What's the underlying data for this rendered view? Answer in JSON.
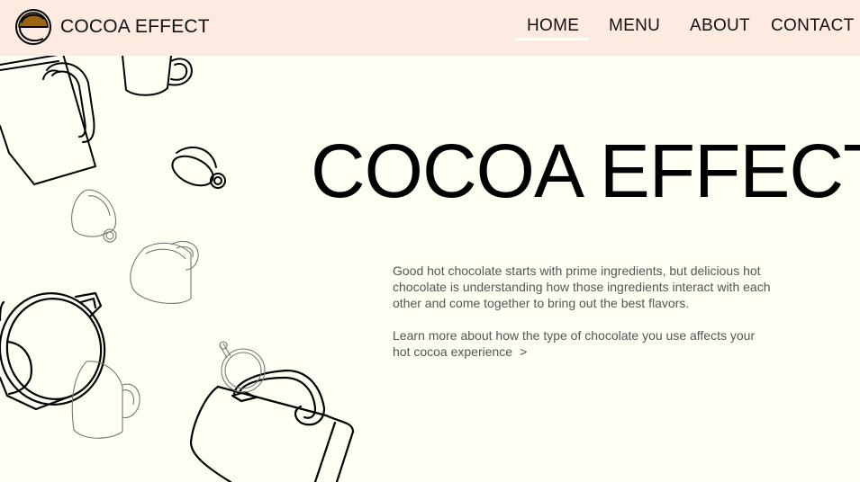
{
  "brand": {
    "name": "COCOA EFFECT",
    "logo_color": "#9a6410"
  },
  "nav": {
    "items": [
      {
        "label": "HOME",
        "active": true
      },
      {
        "label": "MENU"
      },
      {
        "label": "ABOUT"
      },
      {
        "label": "CONTACT"
      }
    ]
  },
  "hero": {
    "title": "COCOA EFFECT",
    "paragraph": "Good hot chocolate starts with prime ingredients, but delicious hot chocolate is understanding how those ingredients interact with each other and come together to bring out the best flavors.",
    "learn_more": "Learn more about how the type of chocolate you use affects your hot cocoa experience",
    "learn_more_chevron": ">"
  },
  "colors": {
    "page_background": "#fefef3",
    "navbar_background": "#fdebe1",
    "text": "#111111",
    "body_text": "#555555"
  },
  "icons": [
    "cocoa-logo-icon",
    "mug-illustration",
    "cup-illustration",
    "chevron-right-icon"
  ]
}
